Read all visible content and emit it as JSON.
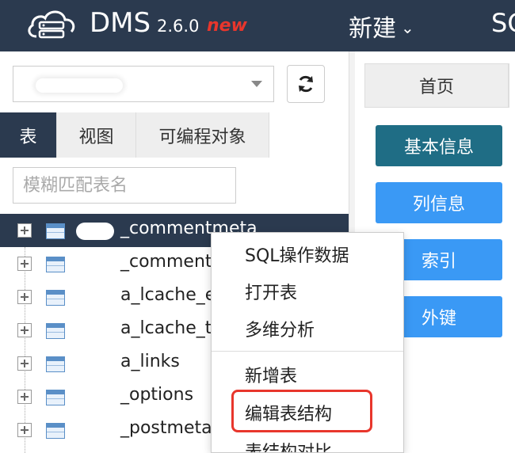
{
  "header": {
    "brand": "DMS",
    "version": "2.6.0",
    "new_tag": "new",
    "menu_new": "新建",
    "menu_sql": "SQ"
  },
  "left": {
    "db_select_value": "",
    "tabs": [
      "表",
      "视图",
      "可编程对象"
    ],
    "search_placeholder": "模糊匹配表名",
    "tables": [
      {
        "name": "_commentmeta",
        "selected": true
      },
      {
        "name": "_comments"
      },
      {
        "name": "a_lcache_eve"
      },
      {
        "name": "a_lcache_tag"
      },
      {
        "name": "a_links"
      },
      {
        "name": "_options"
      },
      {
        "name": "_postmeta"
      }
    ]
  },
  "right": {
    "tab_home": "首页",
    "buttons": [
      "基本信息",
      "列信息",
      "索引",
      "外键"
    ]
  },
  "context_menu": {
    "items": [
      "SQL操作数据",
      "打开表",
      "多维分析",
      "新增表",
      "编辑表结构",
      "表结构对比"
    ],
    "highlighted": "编辑表结构"
  },
  "colors": {
    "navbar": "#2b3a4f",
    "accent_blue": "#3a99f5",
    "accent_dark": "#1f6d85",
    "highlight_red": "#e8362c"
  },
  "icons": [
    "cloud-server-logo-icon",
    "chevron-down-icon",
    "dropdown-caret-icon",
    "refresh-icon",
    "tree-expand-icon",
    "table-icon"
  ]
}
